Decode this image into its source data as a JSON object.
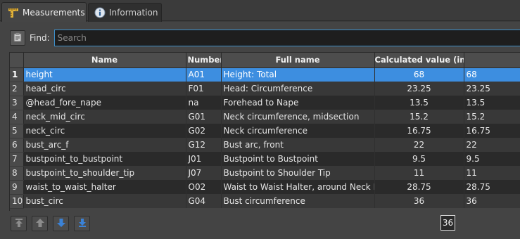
{
  "tabs": [
    {
      "label": "Measurements",
      "icon": "ruler-icon",
      "active": true
    },
    {
      "label": "Information",
      "icon": "info-icon",
      "active": false
    }
  ],
  "search": {
    "label": "Find:",
    "placeholder": "Search",
    "value": ""
  },
  "table": {
    "columns": [
      "Name",
      "Number",
      "Full name",
      "Calculated value (inch)",
      ""
    ],
    "rows": [
      {
        "index": "1",
        "name": "height",
        "number": "A01",
        "full_name": "Height: Total",
        "calculated": "68",
        "value": "68"
      },
      {
        "index": "2",
        "name": "head_circ",
        "number": "F01",
        "full_name": "Head: Circumference",
        "calculated": "23.25",
        "value": "23.25"
      },
      {
        "index": "3",
        "name": "@head_fore_nape",
        "number": "na",
        "full_name": "Forehead to Nape",
        "calculated": "13.5",
        "value": "13.5"
      },
      {
        "index": "4",
        "name": "neck_mid_circ",
        "number": "G01",
        "full_name": "Neck circumference, midsection",
        "calculated": "15.2",
        "value": "15.2"
      },
      {
        "index": "5",
        "name": "neck_circ",
        "number": "G02",
        "full_name": "Neck circumference",
        "calculated": "16.75",
        "value": "16.75"
      },
      {
        "index": "6",
        "name": "bust_arc_f",
        "number": "G12",
        "full_name": "Bust arc, front",
        "calculated": "22",
        "value": "22"
      },
      {
        "index": "7",
        "name": "bustpoint_to_bustpoint",
        "number": "J01",
        "full_name": "Bustpoint to Bustpoint",
        "calculated": "9.5",
        "value": "9.5"
      },
      {
        "index": "8",
        "name": "bustpoint_to_shoulder_tip",
        "number": "J07",
        "full_name": "Bustpoint to Shoulder Tip",
        "calculated": "11",
        "value": "11"
      },
      {
        "index": "9",
        "name": "waist_to_waist_halter",
        "number": "O02",
        "full_name": "Waist to Waist Halter, around Neck Back",
        "calculated": "28.75",
        "value": "28.75"
      },
      {
        "index": "10",
        "name": "bust_circ",
        "number": "G04",
        "full_name": "Bust circumference",
        "calculated": "36",
        "value": "36"
      }
    ],
    "selected_row": 0
  },
  "move_buttons": [
    {
      "name": "move-top-button",
      "icon": "arrow-top-icon"
    },
    {
      "name": "move-up-button",
      "icon": "arrow-up-icon"
    },
    {
      "name": "move-down-button",
      "icon": "arrow-down-icon"
    },
    {
      "name": "move-bottom-button",
      "icon": "arrow-bottom-icon"
    }
  ],
  "value_badge": "36",
  "colors": {
    "accent": "#3d8ee0",
    "background": "#444444",
    "row_dark": "#2a2a2a",
    "row_light": "#383838"
  }
}
